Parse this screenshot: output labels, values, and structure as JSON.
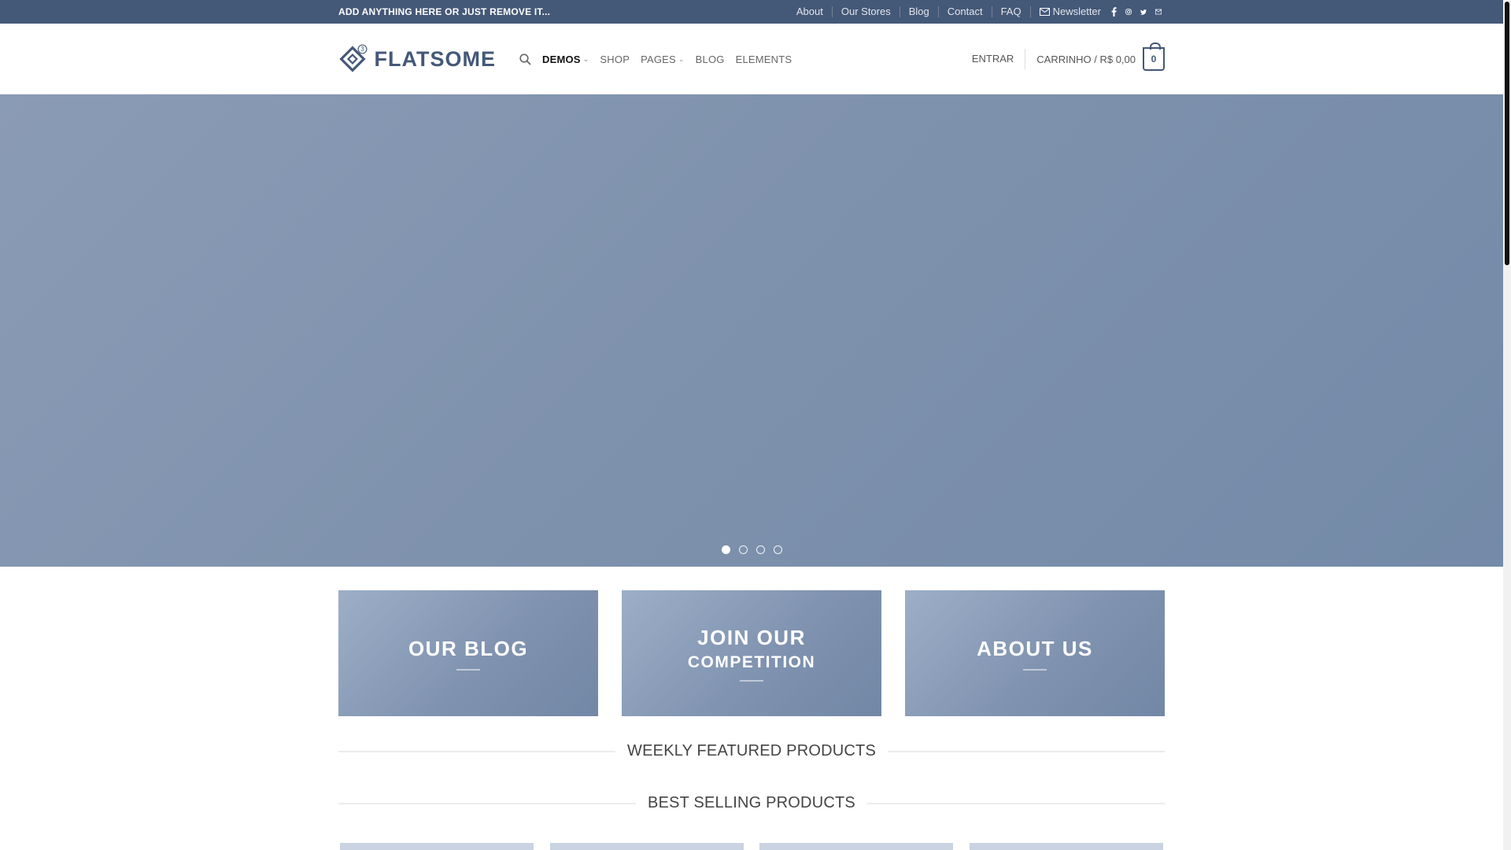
{
  "topbar": {
    "promo": "ADD ANYTHING HERE OR JUST REMOVE IT...",
    "links": [
      "About",
      "Our Stores",
      "Blog",
      "Contact",
      "FAQ"
    ],
    "newsletter": "Newsletter",
    "social": [
      "facebook-icon",
      "instagram-icon",
      "twitter-icon",
      "email-icon"
    ]
  },
  "header": {
    "logo_text": "FLATSOME",
    "nav": [
      "DEMOS",
      "SHOP",
      "PAGES",
      "BLOG",
      "ELEMENTS"
    ],
    "login": "ENTRAR",
    "cart_label": "CARRINHO / R$ 0,00",
    "cart_count": "0"
  },
  "hero": {
    "slides": 4,
    "active_slide": 1
  },
  "banners": [
    {
      "line1": "OUR BLOG",
      "line2": ""
    },
    {
      "line1": "JOIN OUR",
      "line2": "COMPETITION"
    },
    {
      "line1": "ABOUT US",
      "line2": ""
    }
  ],
  "sections": {
    "weekly": "WEEKLY FEATURED PRODUCTS",
    "best": "BEST SELLING PRODUCTS"
  },
  "colors": {
    "brand": "#445878",
    "hero": "#8093b0"
  }
}
